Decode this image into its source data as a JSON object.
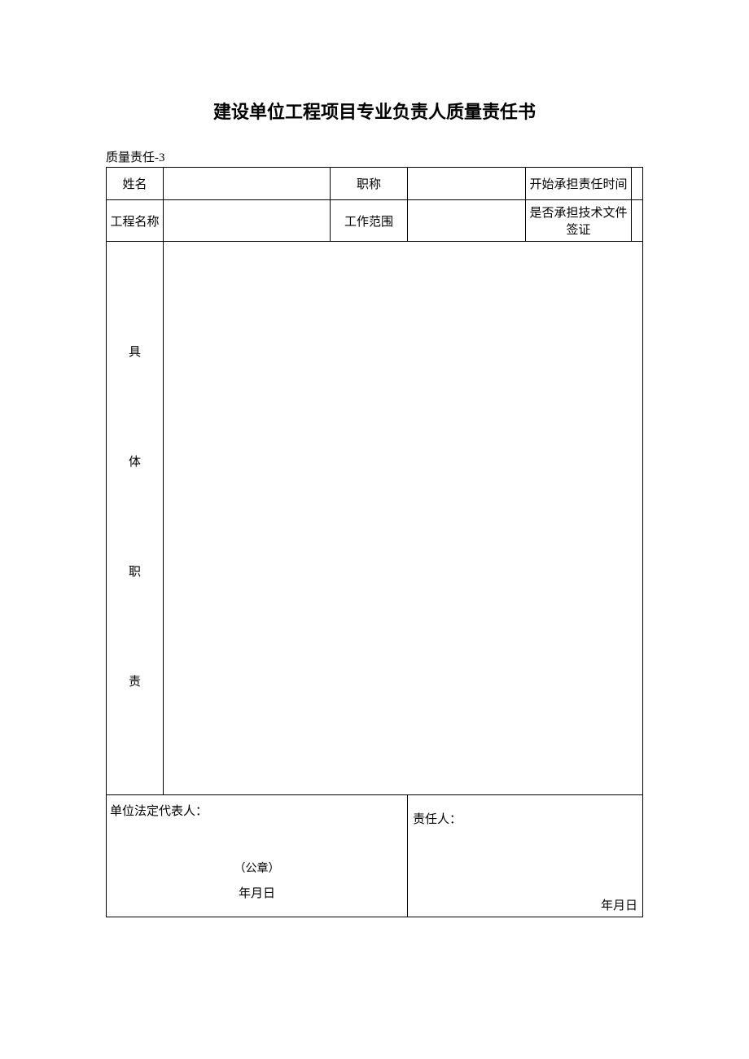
{
  "title": "建设单位工程项目专业负责人质量责任书",
  "subtitle": "质量责任-3",
  "row1": {
    "c1": "姓名",
    "c2": "",
    "c3": "职称",
    "c4": "",
    "c5": "开始承担责任时间",
    "c6": ""
  },
  "row2": {
    "c1": "工程名称",
    "c2": "",
    "c3": "工作范围",
    "c4": "",
    "c5": "是否承担技术文件签证",
    "c6": ""
  },
  "duties": {
    "label_chars": "具\n\n体\n\n职\n\n责",
    "content": ""
  },
  "sig": {
    "left_label": "单位法定代表人：",
    "seal": "（公章）",
    "left_date": "年月日",
    "right_label": "责任人：",
    "right_date": "年月日"
  }
}
